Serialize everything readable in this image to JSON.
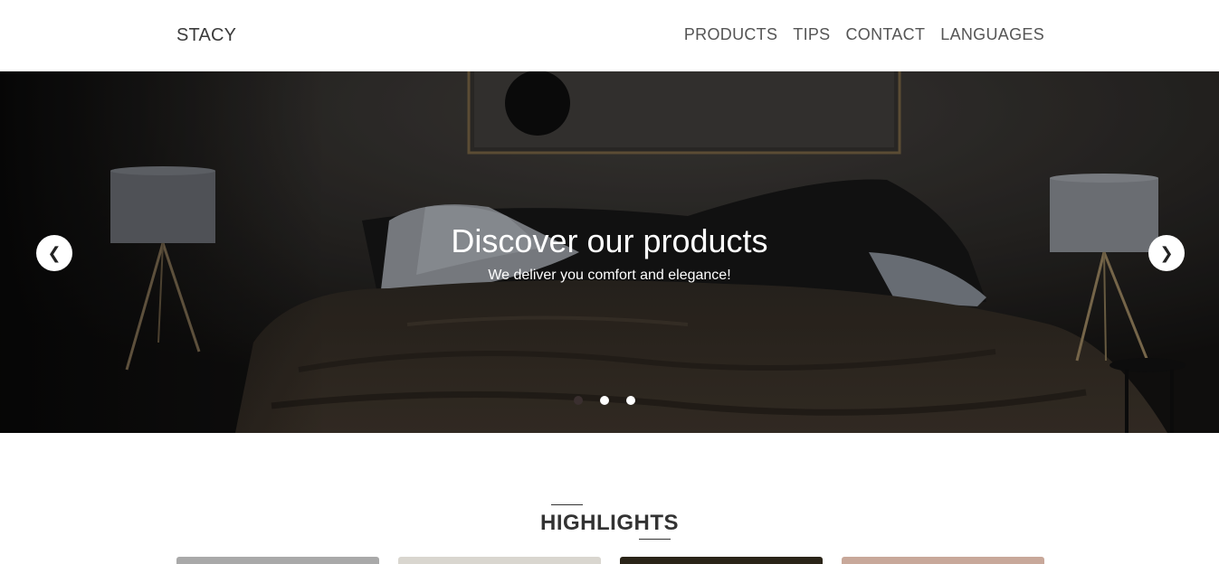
{
  "header": {
    "brand": "STACY",
    "nav": [
      {
        "label": "PRODUCTS"
      },
      {
        "label": "TIPS"
      },
      {
        "label": "CONTACT"
      },
      {
        "label": "LANGUAGES"
      }
    ]
  },
  "hero": {
    "title": "Discover our products",
    "subtitle": "We deliver you comfort and elegance!",
    "prev_icon": "❮",
    "next_icon": "❯",
    "slides_count": 3,
    "active_slide": 1
  },
  "highlights": {
    "title": "HIGHLIGHTS",
    "card_colors": [
      "#a9a9a9",
      "#d9d6cf",
      "#2a2418",
      "#c8a89a"
    ]
  }
}
